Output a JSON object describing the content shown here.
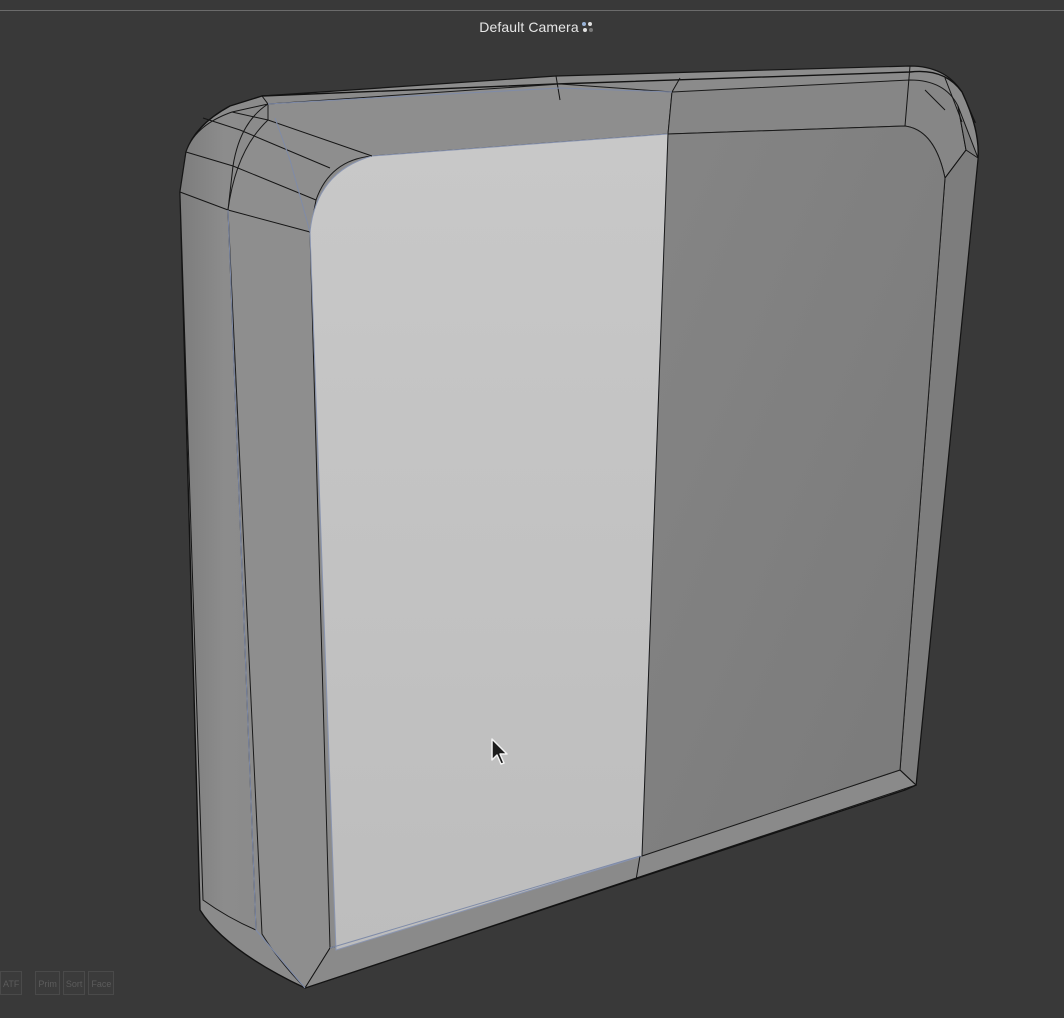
{
  "viewport": {
    "camera_label": "Default Camera",
    "camera_icon": "camera-dots-icon",
    "background_color": "#393939"
  },
  "scene": {
    "object": "rounded-box-mesh",
    "selected_face_color": "#c3c3c3",
    "face_color": "#808080",
    "bevel_color": "#8a8a8a",
    "edge_color": "#151515",
    "selected_edge_color": "#7f8ba8"
  },
  "hud": {
    "buttons": [
      {
        "label": "ATF"
      },
      {
        "label": "Prim"
      },
      {
        "label": "Sort"
      },
      {
        "label": "Face"
      }
    ]
  },
  "cursor": {
    "icon": "mouse-pointer-icon"
  }
}
